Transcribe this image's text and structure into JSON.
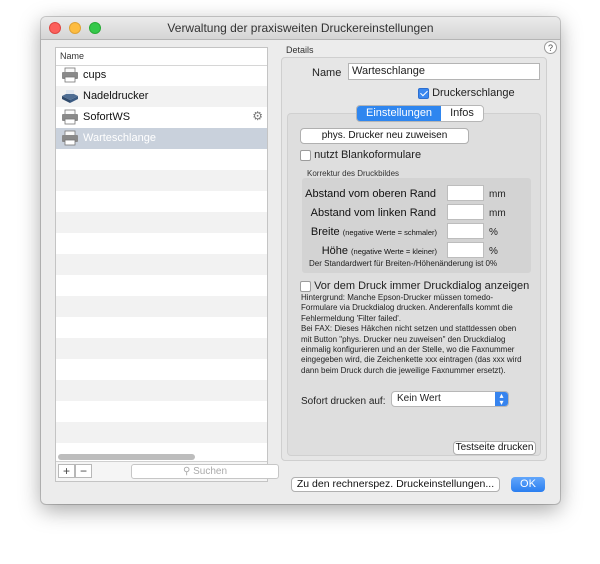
{
  "window": {
    "title": "Verwaltung der praxisweiten Druckereinstellungen"
  },
  "list": {
    "header": "Name",
    "items": [
      {
        "label": "cups",
        "icon": "printer-icon"
      },
      {
        "label": "Nadeldrucker",
        "icon": "dot-matrix-printer-icon"
      },
      {
        "label": "SofortWS",
        "icon": "printer-icon"
      },
      {
        "label": "Warteschlange",
        "icon": "printer-icon",
        "selected": true
      }
    ],
    "add_label": "+",
    "remove_label": "−",
    "search_placeholder": "Suchen"
  },
  "details": {
    "label": "Details",
    "name_label": "Name",
    "name_value": "Warteschlange",
    "druckerschlange_label": "Druckerschlange",
    "druckerschlange_checked": true,
    "tabs": [
      {
        "label": "Einstellungen",
        "active": true
      },
      {
        "label": "Infos",
        "active": false
      }
    ],
    "reassign_button": "phys. Drucker neu zuweisen",
    "blank_forms_label": "nutzt Blankoformulare",
    "blank_forms_checked": false,
    "correction_group_label": "Korrektur des Druckbildes",
    "offset_top_label": "Abstand vom oberen Rand",
    "offset_top_value": "",
    "offset_top_unit": "mm",
    "offset_left_label": "Abstand vom linken Rand",
    "offset_left_value": "",
    "offset_left_unit": "mm",
    "width_label": "Breite",
    "width_hint": "(negative Werte = schmaler)",
    "width_value": "",
    "width_unit": "%",
    "height_label": "Höhe",
    "height_hint": "(negative Werte = kleiner)",
    "height_value": "",
    "height_unit": "%",
    "default_note": "Der Standardwert für Breiten-/Höhenänderung ist 0%",
    "dialog_label": "Vor dem Druck immer Druckdialog anzeigen",
    "dialog_checked": false,
    "help_text_1": "Hintergrund: Manche Epson-Drucker müssen tomedo-Formulare via Druckdialog drucken. Anderenfalls kommt die Fehlermeldung 'Filter failed'.",
    "help_text_2": "Bei FAX: Dieses Häkchen nicht setzen und stattdessen oben mit Button \"phys. Drucker neu zuweisen\" den Druckdialog einmalig konfigurieren und an der Stelle, wo die Faxnummer eingegeben wird, die Zeichenkette xxx eintragen (das xxx wird dann beim Druck durch die jeweilige Faxnummer ersetzt).",
    "sofort_label": "Sofort drucken auf:",
    "sofort_value": "Kein Wert",
    "test_button": "Testseite drucken"
  },
  "footer": {
    "settings_button": "Zu den rechnerspez. Druckeinstellungen...",
    "ok_button": "OK"
  },
  "colors": {
    "accent": "#2f86ef",
    "selection": "#c9d1dc"
  }
}
